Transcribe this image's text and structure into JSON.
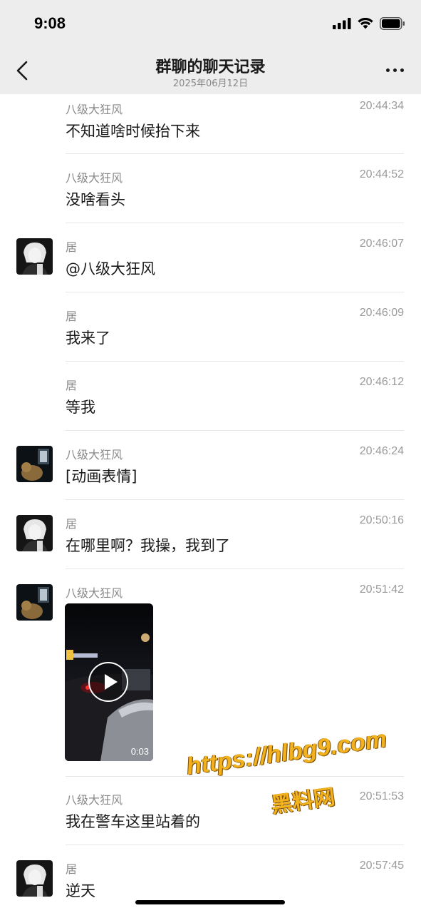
{
  "status_bar": {
    "time": "9:08"
  },
  "nav": {
    "title": "群聊的聊天记录",
    "date": "2025年06月12日"
  },
  "messages": [
    {
      "sender": "八级大狂风",
      "time": "20:44:34",
      "text": "不知道啥时候抬下来"
    },
    {
      "sender": "八级大狂风",
      "time": "20:44:52",
      "text": "没啥看头"
    },
    {
      "sender": "居",
      "time": "20:46:07",
      "text": "@八级大狂风"
    },
    {
      "sender": "居",
      "time": "20:46:09",
      "text": "我来了"
    },
    {
      "sender": "居",
      "time": "20:46:12",
      "text": "等我"
    },
    {
      "sender": "八级大狂风",
      "time": "20:46:24",
      "text": "[动画表情]"
    },
    {
      "sender": "居",
      "time": "20:50:16",
      "text": "在哪里啊？我操，我到了"
    },
    {
      "sender": "八级大狂风",
      "time": "20:51:42",
      "video_duration": "0:03"
    },
    {
      "sender": "八级大狂风",
      "time": "20:51:53",
      "text": "我在警车这里站着的"
    },
    {
      "sender": "居",
      "time": "20:57:45",
      "text": "逆天"
    }
  ],
  "watermark": {
    "url": "https://hlbg9.com",
    "label": "黑料网"
  },
  "colors": {
    "nav_bg": "#ededed",
    "text": "#191919",
    "meta": "#8a8a8a",
    "watermark": "#f2b21d"
  },
  "icons": [
    "back-chevron-icon",
    "more-icon",
    "signal-icon",
    "wifi-icon",
    "battery-icon",
    "play-icon"
  ]
}
